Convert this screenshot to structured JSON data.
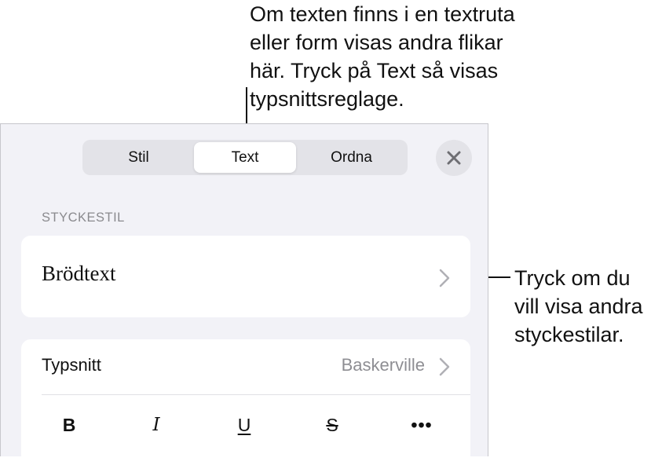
{
  "callouts": {
    "top": "Om texten finns i en textruta\neller form visas andra flikar\nhär. Tryck på Text så visas\ntypsnittsreglage.",
    "right": "Tryck om du\nvill visa andra\nstyckestilar."
  },
  "tabs": [
    {
      "label": "Stil",
      "active": false
    },
    {
      "label": "Text",
      "active": true
    },
    {
      "label": "Ordna",
      "active": false
    }
  ],
  "close_icon": "close-icon",
  "paragraph_style": {
    "section_label": "STYCKESTIL",
    "current": "Brödtext",
    "chevron_icon": "chevron-right-icon"
  },
  "font": {
    "label": "Typsnitt",
    "value": "Baskerville",
    "chevron_icon": "chevron-right-icon"
  },
  "format_buttons": {
    "bold": "B",
    "italic": "I",
    "underline": "U",
    "strikethrough": "S",
    "more": "•••"
  },
  "colors": {
    "panel_bg": "#f2f2f7",
    "card_bg": "#ffffff",
    "segment_bg": "#e3e3e8",
    "secondary_text": "#8e8e93"
  }
}
